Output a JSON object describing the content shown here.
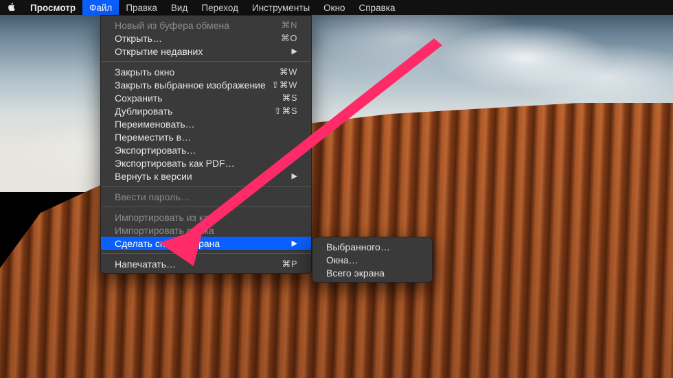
{
  "menubar": {
    "app_name": "Просмотр",
    "items": [
      {
        "label": "Файл",
        "active": true
      },
      {
        "label": "Правка"
      },
      {
        "label": "Вид"
      },
      {
        "label": "Переход"
      },
      {
        "label": "Инструменты"
      },
      {
        "label": "Окно"
      },
      {
        "label": "Справка"
      }
    ]
  },
  "dropdown": {
    "items": [
      {
        "label": "Новый из буфера обмена",
        "shortcut": "⌘N",
        "disabled": true
      },
      {
        "label": "Открыть…",
        "shortcut": "⌘O"
      },
      {
        "label": "Открытие недавних",
        "submenu": true
      },
      {
        "sep": true
      },
      {
        "label": "Закрыть окно",
        "shortcut": "⌘W"
      },
      {
        "label": "Закрыть выбранное изображение",
        "shortcut": "⇧⌘W"
      },
      {
        "label": "Сохранить",
        "shortcut": "⌘S"
      },
      {
        "label": "Дублировать",
        "shortcut": "⇧⌘S"
      },
      {
        "label": "Переименовать…"
      },
      {
        "label": "Переместить в…"
      },
      {
        "label": "Экспортировать…"
      },
      {
        "label": "Экспортировать как PDF…"
      },
      {
        "label": "Вернуть к версии",
        "submenu": true
      },
      {
        "sep": true
      },
      {
        "label": "Ввести пароль…",
        "disabled": true
      },
      {
        "sep": true
      },
      {
        "label": "Импортировать из кам",
        "disabled": true
      },
      {
        "label": "Импортировать со ска",
        "disabled": true
      },
      {
        "label": "Сделать снимок экрана",
        "submenu": true,
        "highlight": true
      },
      {
        "sep": true
      },
      {
        "label": "Напечатать…",
        "shortcut": "⌘P"
      }
    ]
  },
  "submenu": {
    "items": [
      {
        "label": "Выбранного…"
      },
      {
        "label": "Окна…"
      },
      {
        "label": "Всего экрана"
      }
    ]
  },
  "annotation": {
    "arrow_color": "#ff2a68"
  }
}
